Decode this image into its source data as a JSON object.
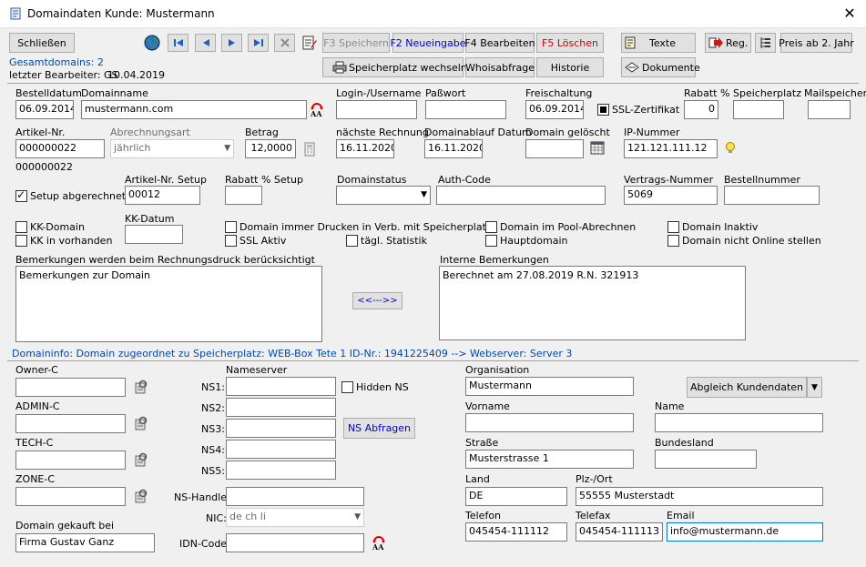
{
  "window": {
    "title": "Domaindaten Kunde: Mustermann",
    "close": "✕"
  },
  "toolbar": {
    "close_label": "Schließen",
    "save_label": "F3 Speichern",
    "new_label": "F2 Neueingabe",
    "edit_label": "F4 Bearbeiten",
    "delete_label": "F5 Löschen",
    "texts_label": "Texte",
    "reg_label": "Reg.",
    "price_label": "Preis ab 2. Jahr",
    "storage_switch_label": "Speicherplatz wechseln",
    "whois_label": "Whoisabfrage",
    "history_label": "Historie",
    "documents_label": "Dokumente"
  },
  "info": {
    "total_domains": "Gesamtdomains: 2",
    "last_editor_label": "letzter Bearbeiter: GS",
    "last_edit_date": "10.04.2019"
  },
  "form": {
    "order_date": {
      "label": "Bestelldatum",
      "value": "06.09.2014"
    },
    "domain_name": {
      "label": "Domainname",
      "value": "mustermann.com"
    },
    "login": {
      "label": "Login-/Username",
      "value": ""
    },
    "password": {
      "label": "Paßwort",
      "value": ""
    },
    "activation": {
      "label": "Freischaltung",
      "value": "06.09.2014"
    },
    "ssl": {
      "label": "SSL-Zertifikat"
    },
    "discount": {
      "label": "Rabatt %",
      "value": "0"
    },
    "storage": {
      "label": "Speicherplatz",
      "value": ""
    },
    "mail_storage": {
      "label": "Mailspeicher",
      "value": ""
    },
    "article_no": {
      "label": "Artikel-Nr.",
      "value": "000000022",
      "below": "000000022"
    },
    "billing_type": {
      "label": "Abrechnungsart",
      "value": "jährlich"
    },
    "amount": {
      "label": "Betrag",
      "value": "12,0000"
    },
    "next_invoice": {
      "label": "nächste Rechnung",
      "value": "16.11.2020"
    },
    "domain_expiry": {
      "label": "Domainablauf Datum",
      "value": "16.11.2020"
    },
    "domain_deleted": {
      "label": "Domain gelöscht",
      "value": ""
    },
    "ip": {
      "label": "IP-Nummer",
      "value": "121.121.111.12"
    },
    "setup_charged": {
      "label": "Setup abgerechnet"
    },
    "setup_article": {
      "label": "Artikel-Nr. Setup",
      "value": "00012"
    },
    "setup_discount": {
      "label": "Rabatt % Setup",
      "value": ""
    },
    "domain_status": {
      "label": "Domainstatus",
      "value": ""
    },
    "auth_code": {
      "label": "Auth-Code",
      "value": ""
    },
    "contract_no": {
      "label": "Vertrags-Nummer",
      "value": "5069"
    },
    "order_no": {
      "label": "Bestellnummer",
      "value": ""
    },
    "kk_date": {
      "label": "KK-Datum",
      "value": ""
    },
    "checkboxes": {
      "kk_domain": "KK-Domain",
      "kk_in": "KK in vorhanden",
      "always_print": "Domain immer Drucken in Verb. mit Speicherplatz",
      "ssl_active": "SSL Aktiv",
      "daily_stats": "tägl. Statistik",
      "pool_billing": "Domain im Pool-Abrechnen",
      "main_domain": "Hauptdomain",
      "inactive": "Domain Inaktiv",
      "not_online": "Domain nicht Online stellen"
    },
    "remarks": {
      "label": "Bemerkungen werden beim Rechnungsdruck berücksichtigt",
      "value": "Bemerkungen zur Domain"
    },
    "copy_label": "<<--->>",
    "internal_remarks": {
      "label": "Interne Bemerkungen",
      "value": "Berechnet am 27.08.2019 R.N. 321913"
    }
  },
  "domaininfo": "Domaininfo:  Domain zugeordnet zu Speicherplatz: WEB-Box Tete 1  ID-Nr.: 1941225409  -->  Webserver: Server 3",
  "contacts": {
    "owner_c": "Owner-C",
    "admin_c": "ADMIN-C",
    "tech_c": "TECH-C",
    "zone_c": "ZONE-C",
    "bought_at_label": "Domain gekauft bei",
    "bought_at_value": "Firma Gustav Ganz"
  },
  "nameserver": {
    "title": "Nameserver",
    "ns1": "NS1:",
    "ns2": "NS2:",
    "ns3": "NS3:",
    "ns4": "NS4:",
    "ns5": "NS5:",
    "hidden_ns": "Hidden NS",
    "query_label": "NS Abfragen",
    "handle_label": "NS-Handle:",
    "nic_label": "NIC:",
    "nic_value": "de ch li",
    "idn_label": "IDN-Code:"
  },
  "customer": {
    "org": {
      "label": "Organisation",
      "value": "Mustermann"
    },
    "sync_label": "Abgleich Kundendaten",
    "firstname": {
      "label": "Vorname",
      "value": ""
    },
    "lastname": {
      "label": "Name",
      "value": ""
    },
    "street": {
      "label": "Straße",
      "value": "Musterstrasse 1"
    },
    "state": {
      "label": "Bundesland",
      "value": ""
    },
    "country": {
      "label": "Land",
      "value": "DE"
    },
    "zip_city": {
      "label": "Plz-/Ort",
      "value": "55555 Musterstadt"
    },
    "phone": {
      "label": "Telefon",
      "value": "045454-111112"
    },
    "fax": {
      "label": "Telefax",
      "value": "045454-111113"
    },
    "email": {
      "label": "Email",
      "value": "info@mustermann.de"
    }
  }
}
